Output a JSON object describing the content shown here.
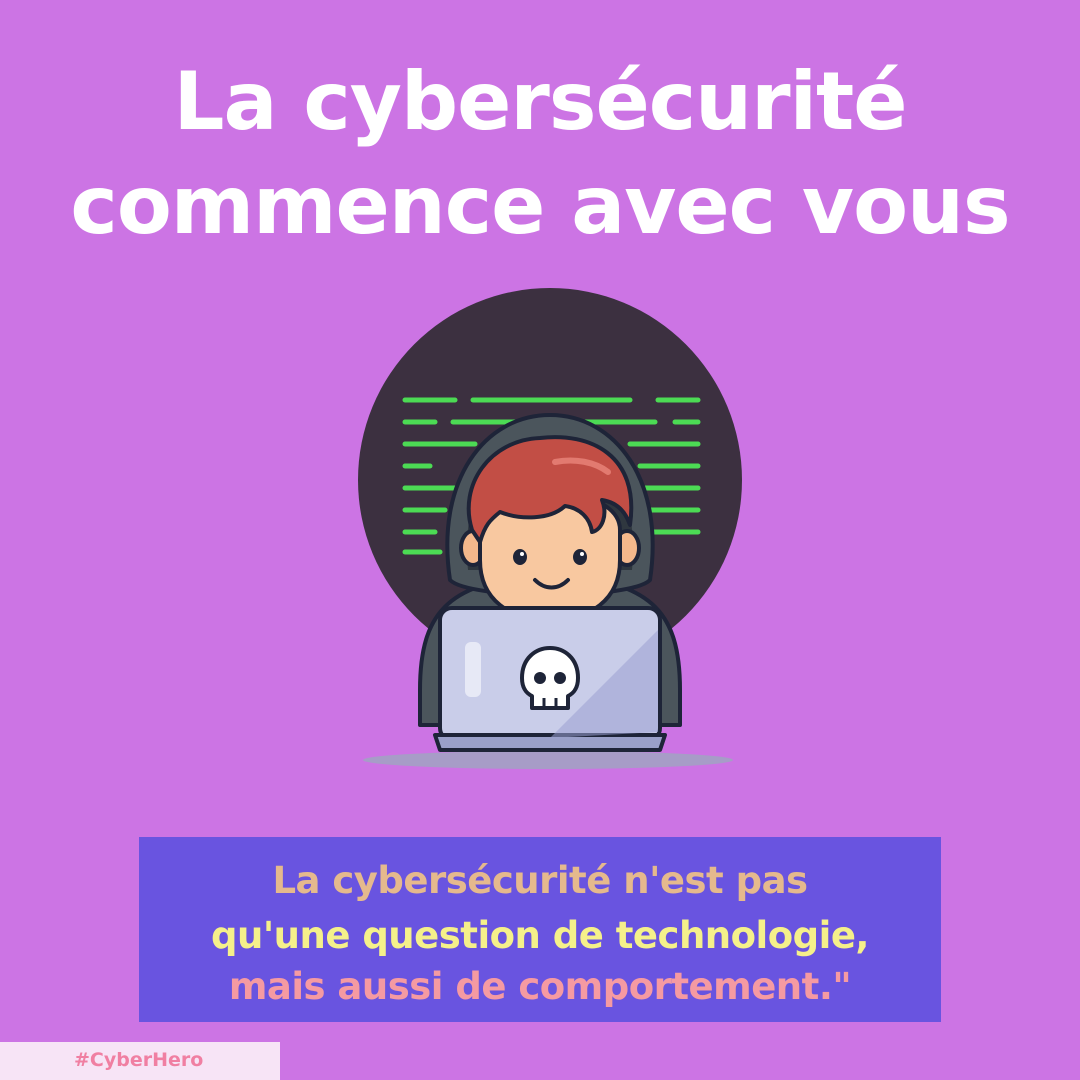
{
  "title": {
    "line1": "La cybersécurité",
    "line2": "commence avec vous"
  },
  "illustration": {
    "description_icon": "hacker-at-laptop-icon",
    "laptop_logo_icon": "skull-icon",
    "colors": {
      "circle": "#3c3040",
      "code_lines": "#4cdb54",
      "hood": "#4b555c",
      "hair": "#c24e45",
      "skin": "#f8c8a0",
      "laptop": "#c9cde9"
    }
  },
  "quote": {
    "line1": "La cybersécurité n'est pas",
    "line2": "qu'une question de technologie,",
    "line3": "mais aussi de comportement.\""
  },
  "hashtag": {
    "text": "#CyberHero"
  },
  "colors": {
    "background": "#cc74e4",
    "quote_box": "#6954e0",
    "quote_line1": "#e5b98d",
    "quote_line2": "#f5f08a",
    "quote_line3": "#f59aa2",
    "hashtag_bg": "#f7e4f6",
    "hashtag_text": "#f07fa2"
  }
}
